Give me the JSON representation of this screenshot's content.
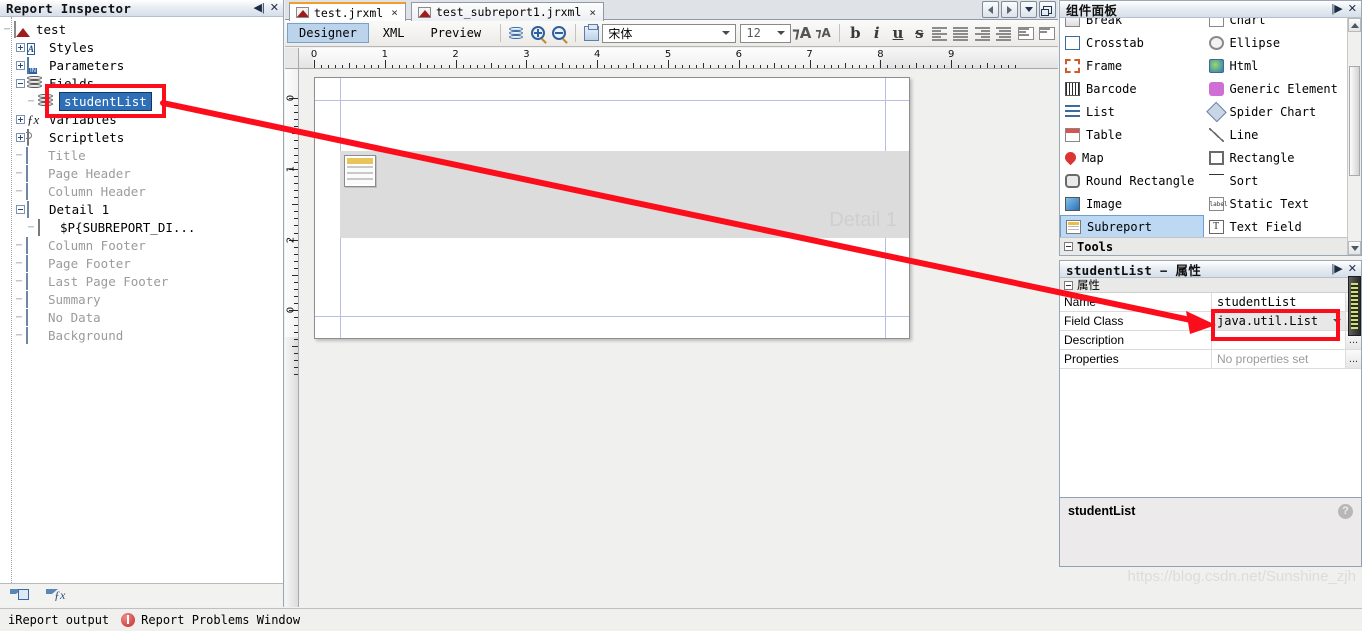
{
  "inspector": {
    "title": "Report Inspector",
    "collapse_icon": "collapse-icon",
    "close_icon": "close-icon",
    "tree": [
      {
        "label": "test",
        "icon": "report-icon",
        "indent": 0,
        "expander": "none",
        "dim": false,
        "selected": false
      },
      {
        "label": "Styles",
        "icon": "styles-icon",
        "indent": 1,
        "expander": "plus",
        "dim": false,
        "selected": false
      },
      {
        "label": "Parameters",
        "icon": "parameters-icon",
        "indent": 1,
        "expander": "plus",
        "dim": false,
        "selected": false
      },
      {
        "label": "Fields",
        "icon": "fields-icon",
        "indent": 1,
        "expander": "minus",
        "dim": false,
        "selected": false
      },
      {
        "label": "studentList",
        "icon": "field-icon",
        "indent": 2,
        "expander": "none",
        "dim": false,
        "selected": true
      },
      {
        "label": "Variables",
        "icon": "variables-icon",
        "indent": 1,
        "expander": "plus",
        "dim": false,
        "selected": false
      },
      {
        "label": "Scriptlets",
        "icon": "scriptlets-icon",
        "indent": 1,
        "expander": "plus",
        "dim": false,
        "selected": false
      },
      {
        "label": "Title",
        "icon": "band-icon",
        "indent": 1,
        "expander": "none",
        "dim": true,
        "selected": false
      },
      {
        "label": "Page Header",
        "icon": "band-icon",
        "indent": 1,
        "expander": "none",
        "dim": true,
        "selected": false
      },
      {
        "label": "Column Header",
        "icon": "band-icon",
        "indent": 1,
        "expander": "none",
        "dim": true,
        "selected": false
      },
      {
        "label": "Detail 1",
        "icon": "band-icon",
        "indent": 1,
        "expander": "minus",
        "dim": false,
        "selected": false
      },
      {
        "label": "$P{SUBREPORT_DI...",
        "icon": "subreport-icon",
        "indent": 2,
        "expander": "none",
        "dim": false,
        "selected": false
      },
      {
        "label": "Column Footer",
        "icon": "band-icon",
        "indent": 1,
        "expander": "none",
        "dim": true,
        "selected": false
      },
      {
        "label": "Page Footer",
        "icon": "band-icon",
        "indent": 1,
        "expander": "none",
        "dim": true,
        "selected": false
      },
      {
        "label": "Last Page Footer",
        "icon": "band-icon",
        "indent": 1,
        "expander": "none",
        "dim": true,
        "selected": false
      },
      {
        "label": "Summary",
        "icon": "band-icon",
        "indent": 1,
        "expander": "none",
        "dim": true,
        "selected": false
      },
      {
        "label": "No Data",
        "icon": "band-icon",
        "indent": 1,
        "expander": "none",
        "dim": true,
        "selected": false
      },
      {
        "label": "Background",
        "icon": "band-icon",
        "indent": 1,
        "expander": "none",
        "dim": true,
        "selected": false
      }
    ],
    "toolbar": [
      {
        "icon": "filter-parameters-icon"
      },
      {
        "icon": "filter-variables-icon"
      }
    ]
  },
  "editor": {
    "tabs": [
      {
        "label": "test.jrxml",
        "active": true,
        "close": "×"
      },
      {
        "label": "test_subreport1.jrxml",
        "active": false,
        "close": "×"
      }
    ],
    "tab_nav": [
      {
        "icon": "scroll-left-icon"
      },
      {
        "icon": "scroll-right-icon"
      },
      {
        "icon": "tab-list-dropdown-icon"
      },
      {
        "icon": "maximize-window-icon"
      }
    ],
    "view_tabs": [
      {
        "label": "Designer",
        "active": true
      },
      {
        "label": "XML",
        "active": false
      },
      {
        "label": "Preview",
        "active": false
      }
    ],
    "toolbar": {
      "dataset_icon": "dataset-icon",
      "zoom_in_icon": "zoom-in-icon",
      "zoom_out_icon": "zoom-out-icon",
      "format_icon": "format-painter-icon",
      "font_family": "宋体",
      "font_size": "12",
      "increase_font_icon": "increase-font-icon",
      "decrease_font_icon": "decrease-font-icon",
      "bold_label": "b",
      "italic_label": "i",
      "underline_label": "u",
      "strike_label": "s",
      "align_left_icon": "align-left-icon",
      "align_center_icon": "align-center-icon",
      "align_right_icon": "align-right-icon",
      "align_justify_icon": "align-justify-icon",
      "valign_top_icon": "valign-top-icon",
      "valign_middle_icon": "valign-middle-icon"
    },
    "ruler": {
      "h_labels": [
        "0",
        "1",
        "2",
        "3",
        "4",
        "5",
        "6",
        "7",
        "8",
        "9"
      ],
      "v_labels": [
        "0",
        "1",
        "2",
        "0"
      ]
    },
    "canvas": {
      "band_label": "Detail 1",
      "element_icon": "subreport-element-icon"
    }
  },
  "palette": {
    "title": "组件面板",
    "collapse_icon": "collapse-icon",
    "close_icon": "close-icon",
    "items": [
      {
        "label": "Break",
        "icon": "break-icon"
      },
      {
        "label": "Chart",
        "icon": "chart-icon"
      },
      {
        "label": "Crosstab",
        "icon": "crosstab-icon"
      },
      {
        "label": "Ellipse",
        "icon": "ellipse-icon"
      },
      {
        "label": "Frame",
        "icon": "frame-icon"
      },
      {
        "label": "Html",
        "icon": "html-icon"
      },
      {
        "label": "Barcode",
        "icon": "barcode-icon"
      },
      {
        "label": "Generic Element",
        "icon": "generic-element-icon"
      },
      {
        "label": "List",
        "icon": "list-icon"
      },
      {
        "label": "Spider Chart",
        "icon": "spider-chart-icon"
      },
      {
        "label": "Table",
        "icon": "table-icon"
      },
      {
        "label": "Line",
        "icon": "line-icon"
      },
      {
        "label": "Map",
        "icon": "map-icon"
      },
      {
        "label": "Rectangle",
        "icon": "rectangle-icon"
      },
      {
        "label": "Round Rectangle",
        "icon": "round-rectangle-icon"
      },
      {
        "label": "Sort",
        "icon": "sort-icon"
      },
      {
        "label": "Image",
        "icon": "image-icon"
      },
      {
        "label": "Static Text",
        "icon": "static-text-icon"
      },
      {
        "label": "Subreport",
        "icon": "subreport-icon",
        "selected": true
      },
      {
        "label": "Text Field",
        "icon": "text-field-icon"
      }
    ],
    "tools_label": "Tools"
  },
  "properties": {
    "title": "studentList − 属性",
    "collapse_icon": "collapse-icon",
    "close_icon": "close-icon",
    "section_label": "属性",
    "rows": [
      {
        "name": "Name",
        "value": "studentList",
        "muted": false,
        "combo": false,
        "dots": "..."
      },
      {
        "name": "Field Class",
        "value": "java.util.List",
        "muted": false,
        "combo": true,
        "dots": "..."
      },
      {
        "name": "Description",
        "value": "",
        "muted": false,
        "combo": false,
        "dots": "..."
      },
      {
        "name": "Properties",
        "value": "No properties set",
        "muted": true,
        "combo": false,
        "dots": "..."
      }
    ],
    "help": {
      "text": "studentList",
      "help_icon": "?"
    }
  },
  "watermark": "https://blog.csdn.net/Sunshine_zjh",
  "statusbar": {
    "output_label": "iReport output",
    "problems_label": "Report Problems Window",
    "error_icon": "error-icon"
  },
  "annotation": {
    "color": "#fc0d1b",
    "field_box": "red-highlight-box-field",
    "class_box": "red-highlight-box-field-class",
    "arrow": "red-arrow"
  }
}
